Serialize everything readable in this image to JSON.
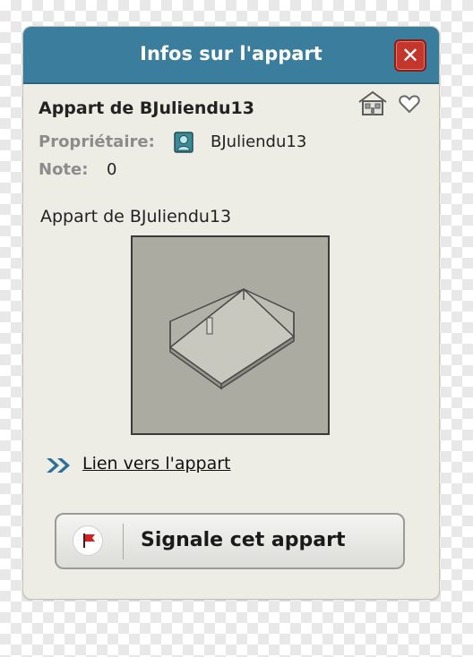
{
  "window": {
    "title": "Infos sur l'appart",
    "close_label": "✕"
  },
  "room": {
    "name": "Appart de BJuliendu13",
    "owner_label": "Propriétaire:",
    "owner_name": "BJuliendu13",
    "rating_label": "Note:",
    "rating_value": "0",
    "description": "Appart de BJuliendu13"
  },
  "icons": {
    "home": "home-icon",
    "favourite": "heart-icon",
    "owner": "user-icon",
    "link": "double-chevron-icon",
    "report": "flag-icon"
  },
  "link": {
    "label": "Lien vers l'appart"
  },
  "report_button": {
    "label": "Signale cet appart"
  },
  "colors": {
    "titlebar": "#3a7d9c",
    "close_button": "#c4352b",
    "panel": "#edede6",
    "thumbnail": "#ababa1",
    "link_arrows": "#2e6f9a",
    "flag": "#d42020"
  }
}
